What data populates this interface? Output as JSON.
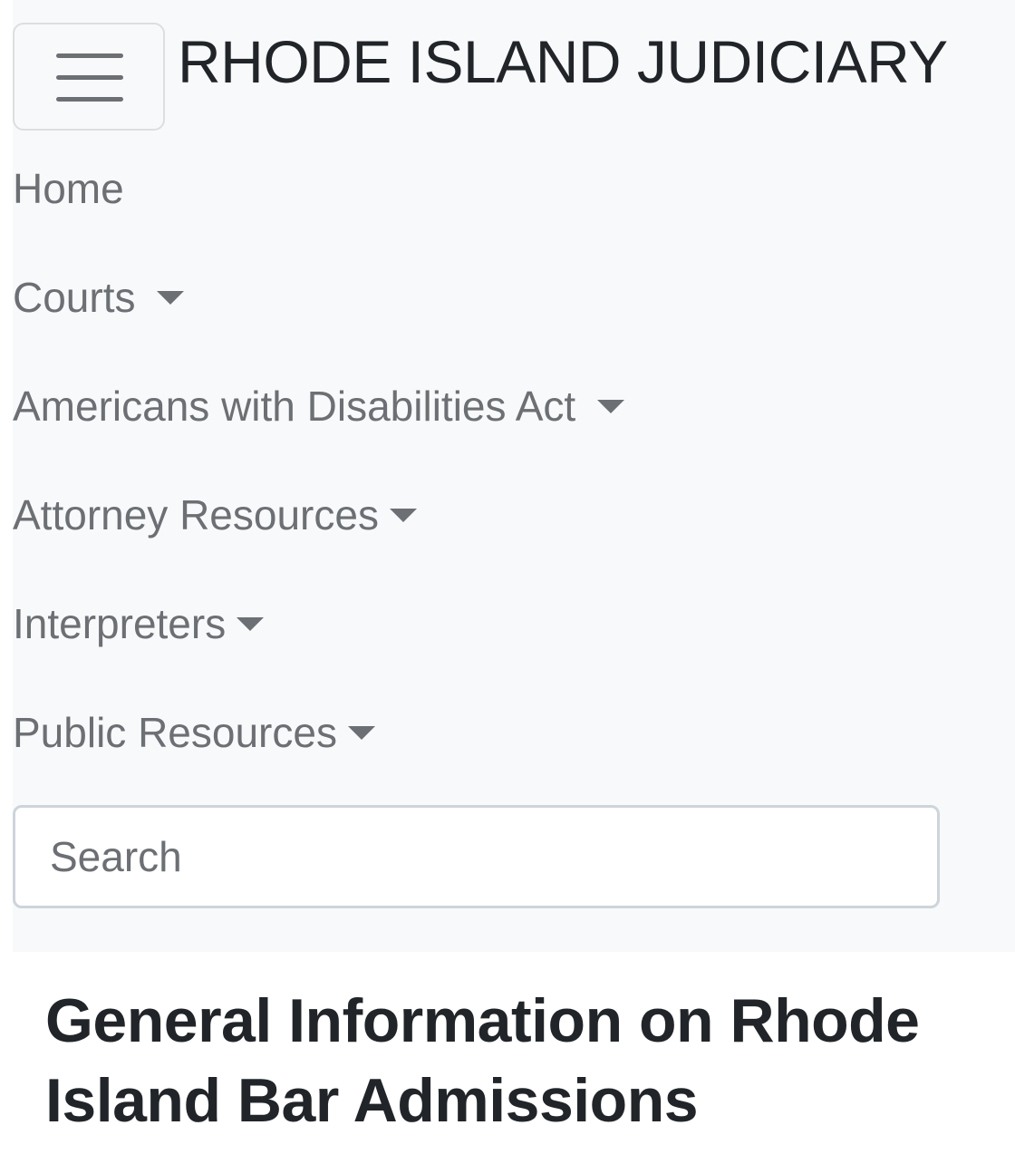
{
  "navbar": {
    "brand": "RHODE ISLAND JUDICIARY",
    "toggler_icon": "hamburger-menu-icon",
    "items": [
      {
        "label": "Home",
        "dropdown": false
      },
      {
        "label": "Courts",
        "dropdown": true
      },
      {
        "label": "Americans with Disabilities Act",
        "dropdown": true
      },
      {
        "label": "Attorney Resources",
        "dropdown": true
      },
      {
        "label": "Interpreters",
        "dropdown": true
      },
      {
        "label": "Public Resources",
        "dropdown": true
      }
    ],
    "search": {
      "placeholder": "Search",
      "value": ""
    }
  },
  "main": {
    "title": "General Information on Rhode Island Bar Admissions"
  },
  "colors": {
    "navbar_bg": "#f8f9fa",
    "nav_link": "#6c6f73",
    "heading": "#212529",
    "input_border": "#ced4da"
  }
}
